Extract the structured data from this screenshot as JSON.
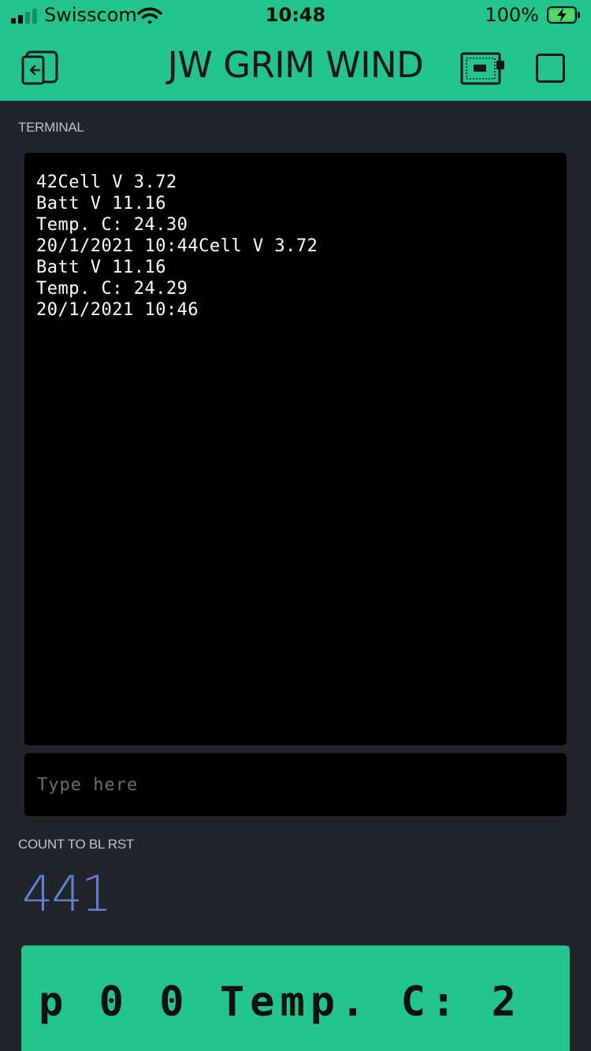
{
  "status_bar": {
    "carrier": "Swisscom",
    "time": "10:48",
    "battery_percent": "100%"
  },
  "header": {
    "title": "JW GRIM WIND"
  },
  "terminal": {
    "label": "TERMINAL",
    "lines": [
      "42Cell V 3.72",
      "Batt V 11.16",
      "Temp. C: 24.30",
      "20/1/2021 10:44Cell V 3.72",
      "Batt V 11.16",
      "Temp. C: 24.29",
      "20/1/2021 10:46"
    ],
    "input_placeholder": "Type here"
  },
  "counter": {
    "label": "COUNT TO BL RST",
    "value": "441"
  },
  "lcd": {
    "line1": "p 0 0 Temp. C: 2"
  },
  "colors": {
    "accent": "#23c48e",
    "background": "#22242a",
    "value_blue": "#5f80d6"
  },
  "icons": {
    "back": "exit-device-icon",
    "device": "device-board-icon",
    "stop": "stop-square-icon",
    "wifi": "wifi-icon",
    "battery": "battery-charging-icon"
  }
}
